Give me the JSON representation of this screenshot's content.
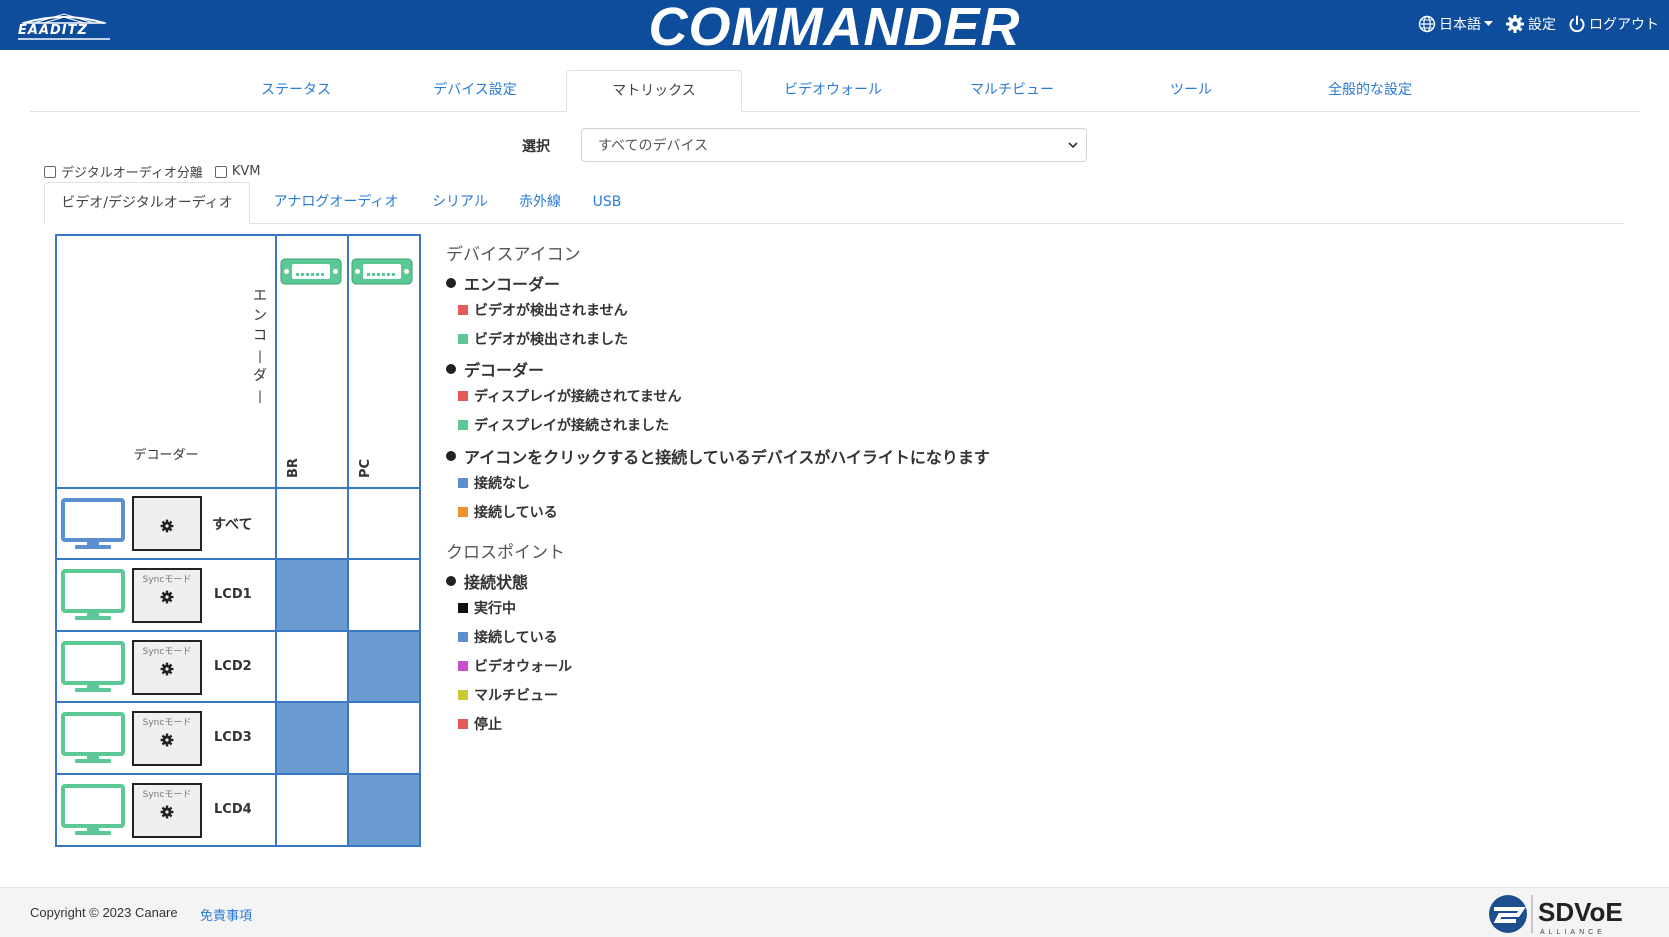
{
  "header": {
    "logo_text": "EAADITZ",
    "brand": "COMMANDER",
    "language": "日本語",
    "settings": "設定",
    "logout": "ログアウト"
  },
  "topnav": {
    "tabs": [
      "ステータス",
      "デバイス設定",
      "マトリックス",
      "ビデオウォール",
      "マルチビュー",
      "ツール",
      "全般的な設定"
    ],
    "active": "マトリックス"
  },
  "select": {
    "label": "選択",
    "value": "すべてのデバイス"
  },
  "checkboxes": {
    "digital_audio": "デジタルオーディオ分離",
    "kvm": "KVM"
  },
  "subnav": {
    "tabs": [
      "ビデオ/デジタルオーディオ",
      "アナログオーディオ",
      "シリアル",
      "赤外線",
      "USB"
    ],
    "active": "ビデオ/デジタルオーディオ"
  },
  "matrix": {
    "encoder_header": "エンコーダー",
    "decoder_header": "デコーダー",
    "encoders": [
      "BR",
      "PC"
    ],
    "all_row": "すべて",
    "sync_label": "Syncモード",
    "decoders": [
      "LCD1",
      "LCD2",
      "LCD3",
      "LCD4"
    ],
    "connections": [
      [
        true,
        false
      ],
      [
        false,
        true
      ],
      [
        true,
        false
      ],
      [
        false,
        true
      ]
    ]
  },
  "legend": {
    "device_icon_title": "デバイスアイコン",
    "encoder_head": "エンコーダー",
    "encoder_no_video": "ビデオが検出されません",
    "encoder_video": "ビデオが検出されました",
    "decoder_head": "デコーダー",
    "decoder_no_display": "ディスプレイが接続されてません",
    "decoder_display": "ディスプレイが接続されました",
    "click_head": "アイコンをクリックすると接続しているデバイスがハイライトになります",
    "not_connected": "接続なし",
    "connected": "接続している",
    "crosspoint_title": "クロスポイント",
    "status_head": "接続状態",
    "running": "実行中",
    "status_connected": "接続している",
    "videowall": "ビデオウォール",
    "multiview": "マルチビュー",
    "stopped": "停止"
  },
  "colors": {
    "header": "#0d4d9c",
    "red": "#e85a5a",
    "green": "#5cc895",
    "blue": "#5b8fcf",
    "orange": "#f0922a",
    "black": "#111111",
    "magenta": "#c84fc8",
    "yellow": "#c8c832",
    "cell_on": "#6a9bd1"
  },
  "footer": {
    "copyright": "Copyright © 2023 Canare",
    "disclaimer": "免責事項",
    "sdvoe": "SDVoE",
    "sdvoe_sub": "ALLIANCE"
  }
}
